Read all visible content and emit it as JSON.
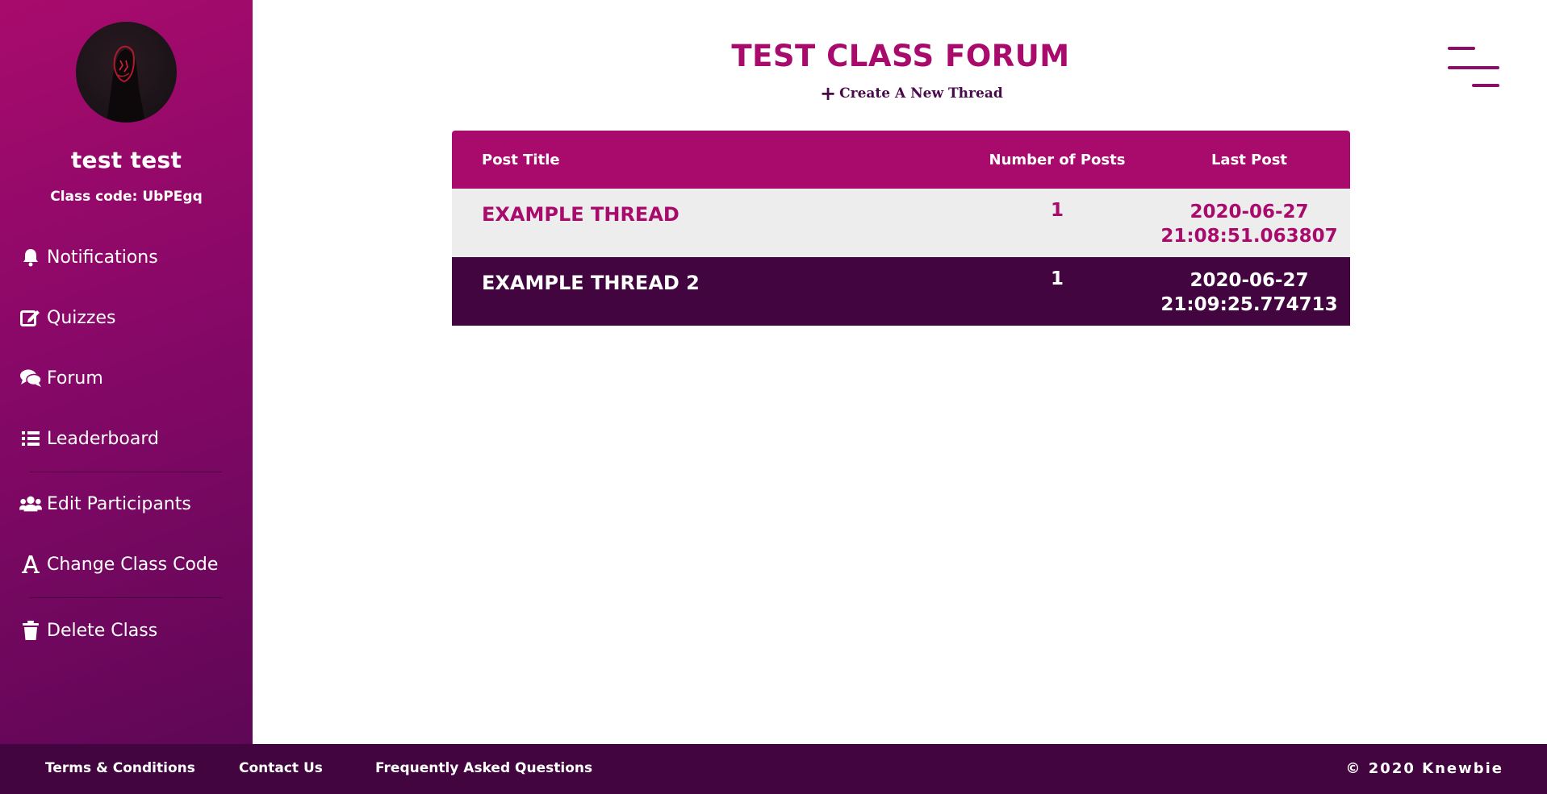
{
  "sidebar": {
    "user_name": "test test",
    "class_code": "Class code: UbPEgq",
    "items": [
      {
        "label": "Notifications",
        "icon": "bell-icon"
      },
      {
        "label": "Quizzes",
        "icon": "edit-icon"
      },
      {
        "label": "Forum",
        "icon": "comments-icon"
      },
      {
        "label": "Leaderboard",
        "icon": "list-icon"
      },
      {
        "label": "Edit Participants",
        "icon": "users-icon"
      },
      {
        "label": "Change Class Code",
        "icon": "font-icon"
      },
      {
        "label": "Delete Class",
        "icon": "trash-icon"
      }
    ]
  },
  "main": {
    "title": "TEST CLASS FORUM",
    "create_thread_label": "Create A New Thread",
    "create_thread_icon": "plus-icon"
  },
  "table": {
    "headers": [
      "Post Title",
      "Number of Posts",
      "Last Post"
    ],
    "rows": [
      {
        "title": "EXAMPLE THREAD",
        "posts": "1",
        "last_date": "2020-06-27",
        "last_time": "21:08:51.063807"
      },
      {
        "title": "EXAMPLE THREAD 2",
        "posts": "1",
        "last_date": "2020-06-27",
        "last_time": "21:09:25.774713"
      }
    ]
  },
  "footer": {
    "links": [
      "Terms & Conditions",
      "Contact Us",
      "Frequently Asked Questions"
    ],
    "copyright": "© 2020 Knewbie"
  },
  "colors": {
    "brand": "#a80b6c",
    "dark": "#42053f",
    "row_light": "#ededed"
  }
}
